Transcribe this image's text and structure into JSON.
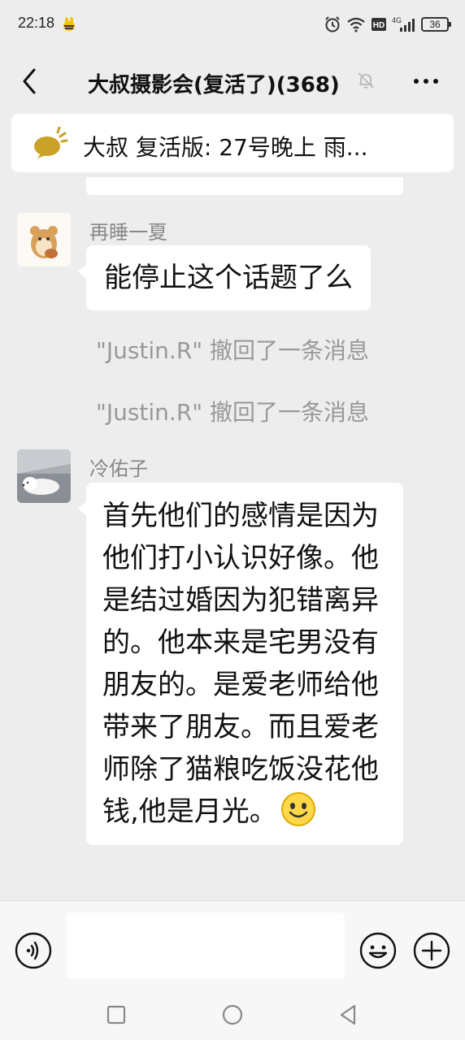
{
  "status_bar": {
    "time": "22:18",
    "network": "4G",
    "battery": "36"
  },
  "header": {
    "title": "大叔摄影会(复活了)(368)",
    "back_icon": "chevron-left-icon",
    "mute_icon": "bell-off-icon",
    "more_icon": "more-dots-icon"
  },
  "pinned": {
    "icon": "announcement-icon",
    "text": "大叔 复活版: 27号晚上 雨..."
  },
  "messages": [
    {
      "sender": "再睡一夏",
      "text": "能停止这个话题了么"
    },
    {
      "sender": "冷佑子",
      "text": "首先他们的感情是因为他们打小认识好像。他是结过婚因为犯错离异的。他本来是宅男没有朋友的。是爱老师给他带来了朋友。而且爱老师除了猫粮吃饭没花他钱,他是月光。"
    }
  ],
  "system_messages": [
    "\"Justin.R\" 撤回了一条消息",
    "\"Justin.R\" 撤回了一条消息"
  ],
  "input_bar": {
    "voice_icon": "voice-icon",
    "emoji_icon": "emoji-icon",
    "plus_icon": "plus-icon",
    "input_value": ""
  },
  "nav_bar": {
    "recent_icon": "square-icon",
    "home_icon": "circle-icon",
    "back_icon": "triangle-back-icon"
  },
  "colors": {
    "background": "#ededed",
    "bubble": "#ffffff",
    "system_text": "#999999",
    "announcement": "#c9a227"
  }
}
